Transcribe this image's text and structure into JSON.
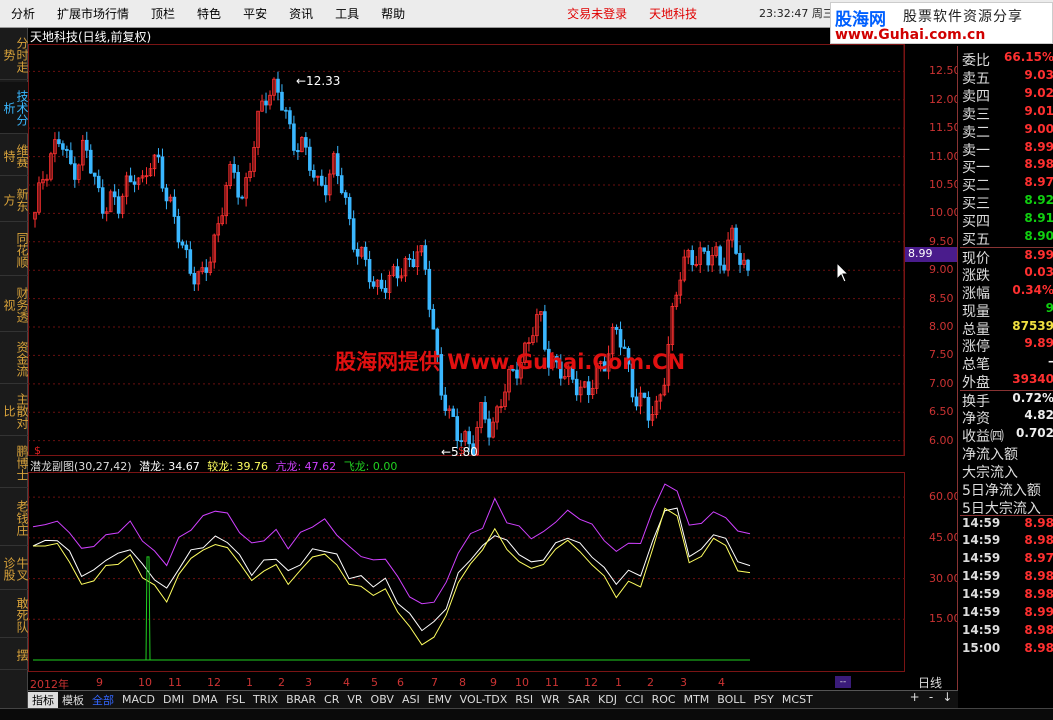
{
  "menu": [
    "分析",
    "扩展市场行情",
    "顶栏",
    "特色",
    "平安",
    "资讯",
    "工具",
    "帮助"
  ],
  "status_menu": {
    "login": "交易未登录",
    "stock": "天地科技"
  },
  "clock": "23:32:47 周三",
  "brand": {
    "logo": "股海网",
    "tag": "股票软件资源分享",
    "url": "www.Guhai.com.cn"
  },
  "left_tabs": [
    "分时走势",
    "技术分析",
    "维赛特",
    "新东方",
    "同花顺",
    "财务透视",
    "资金流",
    "主散对比",
    "鹏博士",
    "老钱庄",
    "牛叉诊股",
    "敢死队",
    "摆"
  ],
  "active_tab": 1,
  "title": "天地科技(日线,前复权)",
  "main_axis": {
    "ylim": [
      5.8,
      12.7
    ],
    "ticks": [
      "12.50",
      "12.00",
      "11.50",
      "11.00",
      "10.50",
      "10.00",
      "9.50",
      "9.00",
      "8.50",
      "8.00",
      "7.50",
      "7.00",
      "6.50",
      "6.00"
    ]
  },
  "current_price": "8.99",
  "high_label": "12.33",
  "low_label": "5.80",
  "watermark": "股海网提供 Www.Guhai.Com.CN",
  "indicator": {
    "name": "潜龙副图(30,27,42)",
    "l1": "潜龙: 34.67",
    "l2": "较龙: 39.76",
    "l3": "亢龙: 47.62",
    "l4": "飞龙: 0.00"
  },
  "sub_axis": {
    "ticks": [
      "60.00",
      "45.00",
      "30.00",
      "15.00"
    ]
  },
  "x_labels": [
    "2012年",
    "9",
    "10",
    "11",
    "12",
    "1",
    "2",
    "3",
    "4",
    "5",
    "6",
    "7",
    "8",
    "9",
    "10",
    "11",
    "12",
    "1",
    "2",
    "3",
    "4"
  ],
  "bottom_tabs": [
    "指标",
    "模板",
    "全部",
    "MACD",
    "DMI",
    "DMA",
    "FSL",
    "TRIX",
    "BRAR",
    "CR",
    "VR",
    "OBV",
    "ASI",
    "EMV",
    "VOL-TDX",
    "RSI",
    "WR",
    "SAR",
    "KDJ",
    "CCI",
    "ROC",
    "MTM",
    "BOLL",
    "PSY",
    "MCST"
  ],
  "right_ctl": [
    "+",
    "-",
    "↓"
  ],
  "period": "日线",
  "quotes": [
    {
      "k": "委比",
      "v": "66.15%",
      "c": "red"
    },
    {
      "k": "卖五",
      "v": "9.03",
      "c": "red"
    },
    {
      "k": "卖四",
      "v": "9.02",
      "c": "red"
    },
    {
      "k": "卖三",
      "v": "9.01",
      "c": "red"
    },
    {
      "k": "卖二",
      "v": "9.00",
      "c": "red"
    },
    {
      "k": "卖一",
      "v": "8.99",
      "c": "red"
    },
    {
      "k": "买一",
      "v": "8.98",
      "c": "red"
    },
    {
      "k": "买二",
      "v": "8.97",
      "c": "red"
    },
    {
      "k": "买三",
      "v": "8.92",
      "c": "green"
    },
    {
      "k": "买四",
      "v": "8.91",
      "c": "green"
    },
    {
      "k": "买五",
      "v": "8.90",
      "c": "green"
    },
    {
      "k": "现价",
      "v": "8.99",
      "c": "red"
    },
    {
      "k": "涨跌",
      "v": "0.03",
      "c": "red"
    },
    {
      "k": "涨幅",
      "v": "0.34%",
      "c": "red"
    },
    {
      "k": "现量",
      "v": "9",
      "c": "green"
    },
    {
      "k": "总量",
      "v": "87539",
      "c": "yellow"
    },
    {
      "k": "涨停",
      "v": "9.89",
      "c": "red"
    },
    {
      "k": "总笔",
      "v": "–",
      "c": "white"
    },
    {
      "k": "外盘",
      "v": "39340",
      "c": "red"
    },
    {
      "k": "换手",
      "v": "0.72%",
      "c": "white"
    },
    {
      "k": "净资",
      "v": "4.82",
      "c": "white"
    },
    {
      "k": "收益㈣",
      "v": "0.702",
      "c": "white"
    },
    {
      "k": "净流入额",
      "v": "",
      "c": "white"
    },
    {
      "k": "大宗流入",
      "v": "",
      "c": "white"
    },
    {
      "k": "5日净流入额",
      "v": "",
      "c": "white"
    },
    {
      "k": "5日大宗流入",
      "v": "",
      "c": "white"
    },
    {
      "k": "14:59",
      "v": "8.98",
      "c": "red"
    },
    {
      "k": "14:59",
      "v": "8.98",
      "c": "red"
    },
    {
      "k": "14:59",
      "v": "8.97",
      "c": "red"
    },
    {
      "k": "14:59",
      "v": "8.98",
      "c": "red"
    },
    {
      "k": "14:59",
      "v": "8.98",
      "c": "red"
    },
    {
      "k": "14:59",
      "v": "8.99",
      "c": "red"
    },
    {
      "k": "14:59",
      "v": "8.98",
      "c": "red"
    },
    {
      "k": "15:00",
      "v": "8.98",
      "c": "red"
    }
  ],
  "colors": {
    "up": "#ff3030",
    "down": "#3ab7ff",
    "grid": "#6a1010",
    "qianlong": "#ffffff",
    "jiaolong": "#ffff60",
    "kanglong": "#d040ff",
    "feilong": "#20d020"
  },
  "chart_data": {
    "type": "line",
    "title": "天地科技(日线,前复权)",
    "price_path": [
      9.9,
      10.7,
      11.1,
      11.3,
      10.8,
      10.9,
      11.2,
      10.6,
      10.2,
      10.3,
      10.0,
      10.5,
      10.8,
      10.4,
      10.9,
      11.0,
      10.2,
      9.7,
      9.4,
      9.0,
      8.7,
      9.2,
      9.8,
      10.4,
      10.7,
      10.3,
      10.9,
      11.6,
      12.2,
      12.3,
      11.8,
      11.2,
      11.4,
      10.9,
      10.4,
      10.6,
      10.9,
      10.4,
      9.8,
      9.4,
      9.0,
      8.6,
      8.9,
      8.8,
      8.9,
      9.2,
      9.4,
      9.0,
      8.0,
      7.0,
      6.3,
      6.1,
      6.1,
      5.9,
      6.5,
      6.2,
      6.7,
      6.9,
      7.3,
      7.6,
      7.9,
      8.1,
      7.5,
      7.3,
      7.0,
      7.2,
      6.9,
      6.8,
      7.3,
      7.6,
      7.9,
      7.6,
      7.0,
      6.7,
      6.4,
      6.6,
      7.3,
      8.2,
      9.1,
      9.4,
      9.1,
      9.2,
      9.4,
      9.1,
      9.5,
      9.3,
      9.0
    ],
    "series": [
      {
        "name": "潜龙",
        "values": [
          42,
          44,
          44,
          40,
          31,
          33,
          37,
          39,
          41,
          35,
          30,
          26,
          34,
          40,
          42,
          45,
          44,
          38,
          32,
          36,
          38,
          32,
          36,
          40,
          41,
          38,
          31,
          30,
          28,
          29,
          22,
          16,
          12,
          13,
          20,
          31,
          38,
          41,
          47,
          43,
          40,
          35,
          38,
          42,
          46,
          42,
          39,
          33,
          29,
          32,
          32,
          43,
          56,
          55,
          39,
          40,
          47,
          44,
          37,
          34
        ]
      },
      {
        "name": "较龙",
        "values": [
          41,
          43,
          42,
          37,
          27,
          30,
          34,
          36,
          38,
          31,
          27,
          22,
          31,
          38,
          40,
          43,
          41,
          36,
          29,
          33,
          35,
          28,
          33,
          38,
          39,
          35,
          28,
          27,
          24,
          26,
          18,
          12,
          6,
          8,
          17,
          28,
          36,
          40,
          49,
          40,
          37,
          33,
          36,
          40,
          45,
          39,
          36,
          30,
          24,
          28,
          28,
          40,
          57,
          52,
          37,
          37,
          46,
          41,
          34,
          31
        ]
      },
      {
        "name": "亢龙",
        "values": [
          48,
          51,
          50,
          48,
          40,
          43,
          45,
          48,
          50,
          45,
          39,
          36,
          44,
          49,
          52,
          56,
          53,
          48,
          42,
          45,
          47,
          42,
          46,
          50,
          51,
          47,
          41,
          39,
          36,
          38,
          30,
          24,
          20,
          22,
          28,
          40,
          46,
          49,
          59,
          51,
          49,
          45,
          47,
          51,
          55,
          52,
          50,
          44,
          40,
          43,
          43,
          55,
          65,
          62,
          50,
          50,
          55,
          52,
          48,
          46
        ]
      },
      {
        "name": "飞龙",
        "values": [
          0,
          0,
          0,
          0,
          0,
          0,
          0,
          0,
          0,
          0,
          0,
          0,
          0,
          0,
          0,
          0,
          0,
          0,
          0,
          0,
          0,
          0,
          0,
          0,
          0,
          0,
          0,
          0,
          0,
          0,
          0,
          0,
          0,
          0,
          0,
          0,
          0,
          0,
          0,
          0,
          0,
          0,
          0,
          0,
          0,
          0,
          0,
          0,
          0,
          0,
          0,
          0,
          0,
          0,
          0,
          0,
          0,
          0,
          0,
          0
        ]
      }
    ],
    "ylim": [
      0,
      70
    ]
  }
}
